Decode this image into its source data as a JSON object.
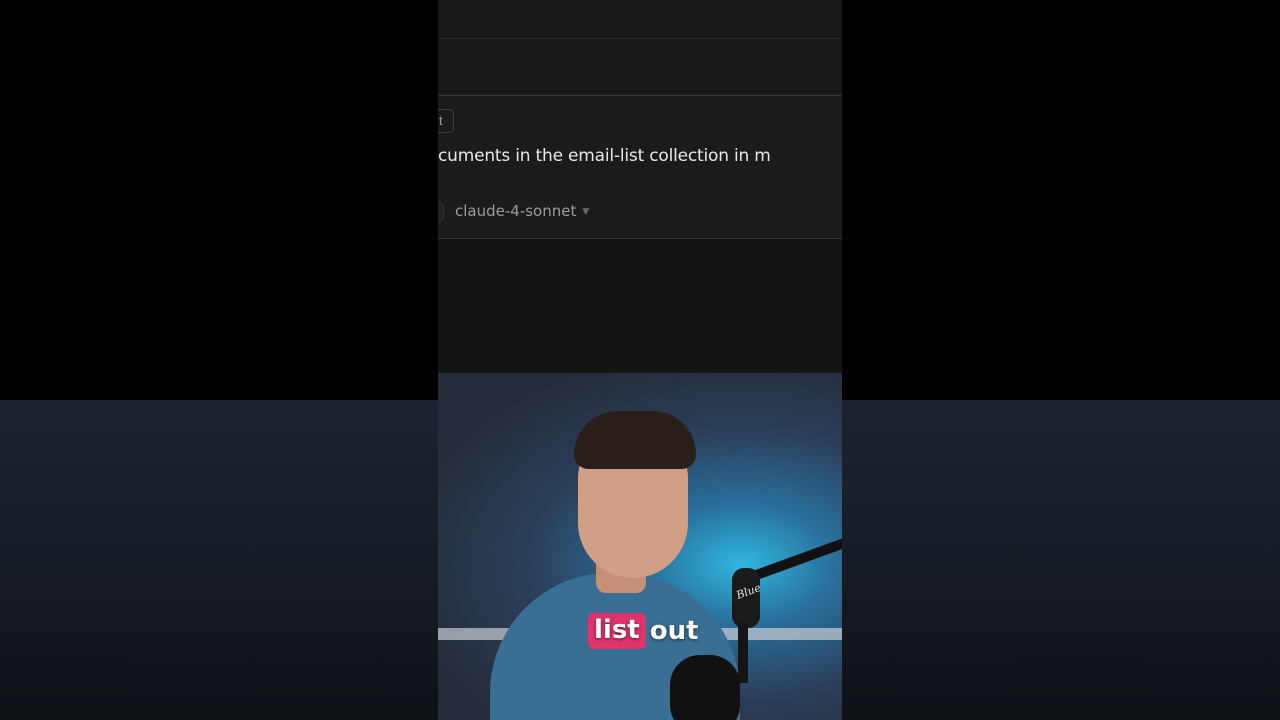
{
  "editor": {
    "context_chip": "t",
    "prompt_text": "cuments in the email-list collection in m",
    "model_select": "claude-4-sonnet",
    "model_chevron_icon": "chevron-down-icon"
  },
  "webcam": {
    "mic_brand": "Blue"
  },
  "caption": {
    "highlighted_word": "list",
    "rest": "out",
    "highlight_color": "#e0336e"
  }
}
